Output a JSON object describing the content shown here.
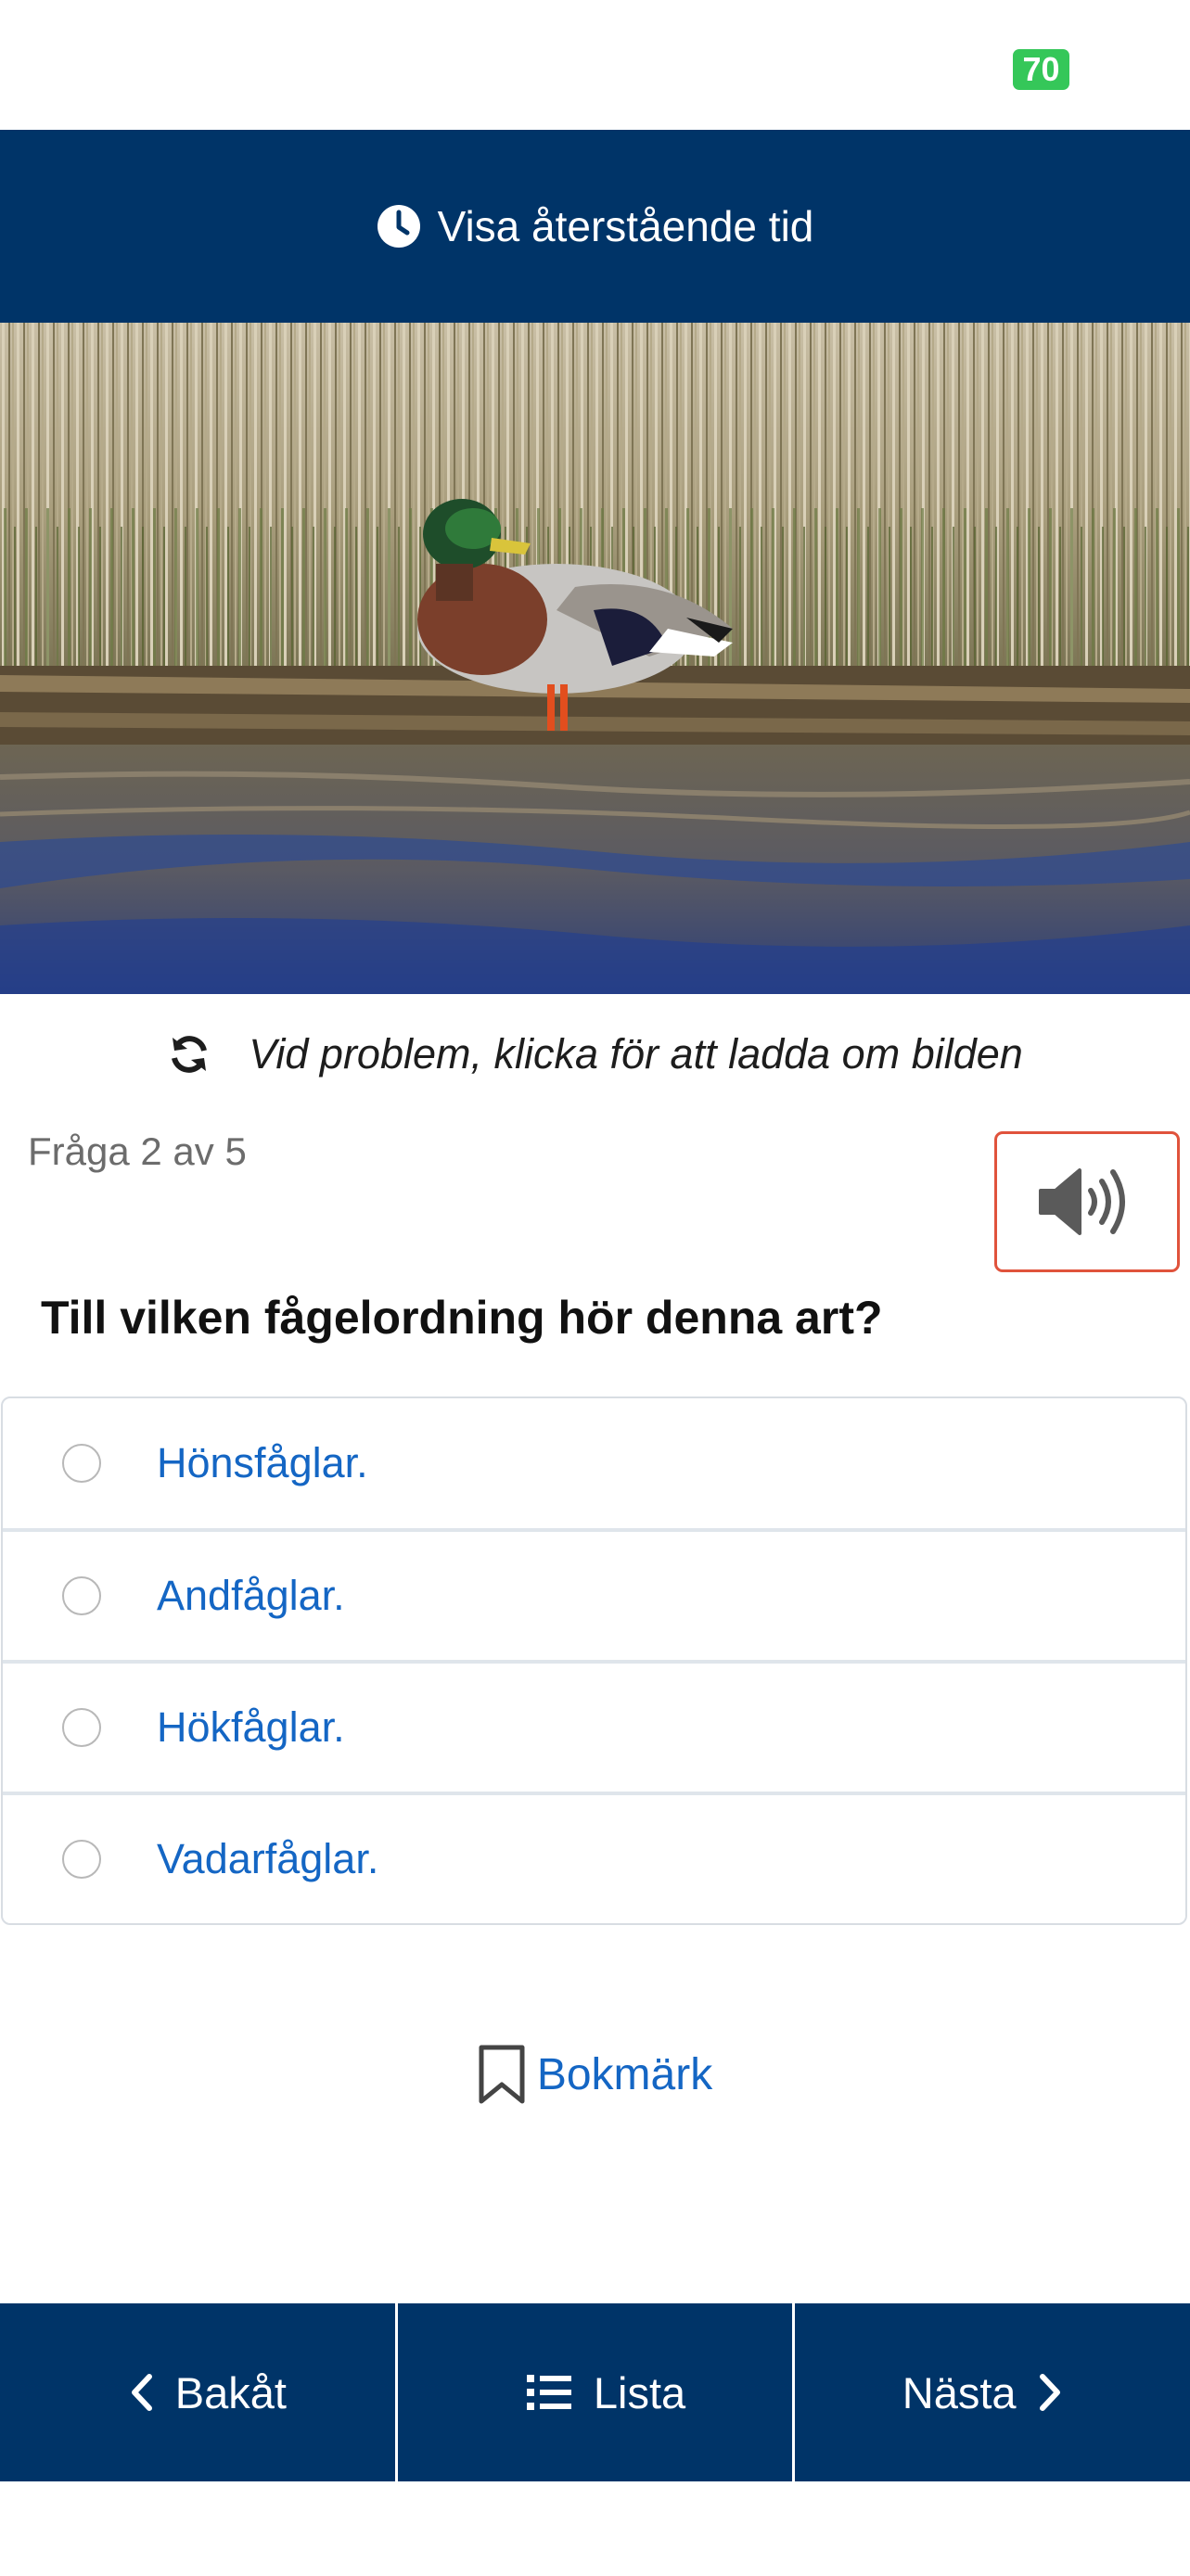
{
  "status_bar": {
    "battery": "70"
  },
  "timer": {
    "label": "Visa återstående tid"
  },
  "image": {
    "reload_text": "Vid problem, klicka för att ladda om bilden"
  },
  "question": {
    "counter": "Fråga 2 av 5",
    "text": "Till vilken fågelordning hör denna art?",
    "answers": [
      "Hönsfåglar.",
      "Andfåglar.",
      "Hökfåglar.",
      "Vadarfåglar."
    ]
  },
  "bookmark": {
    "label": "Bokmärk"
  },
  "nav": {
    "back_label": "Bakåt",
    "list_label": "Lista",
    "next_label": "Nästa"
  },
  "colors": {
    "header_bg": "#003468",
    "link_blue": "#1466c4",
    "battery_green": "#35c759",
    "audio_border": "#e0533c"
  },
  "icons": [
    "clock-icon",
    "reload-icon",
    "speaker-icon",
    "bookmark-icon",
    "chevron-left-icon",
    "list-icon",
    "chevron-right-icon"
  ]
}
